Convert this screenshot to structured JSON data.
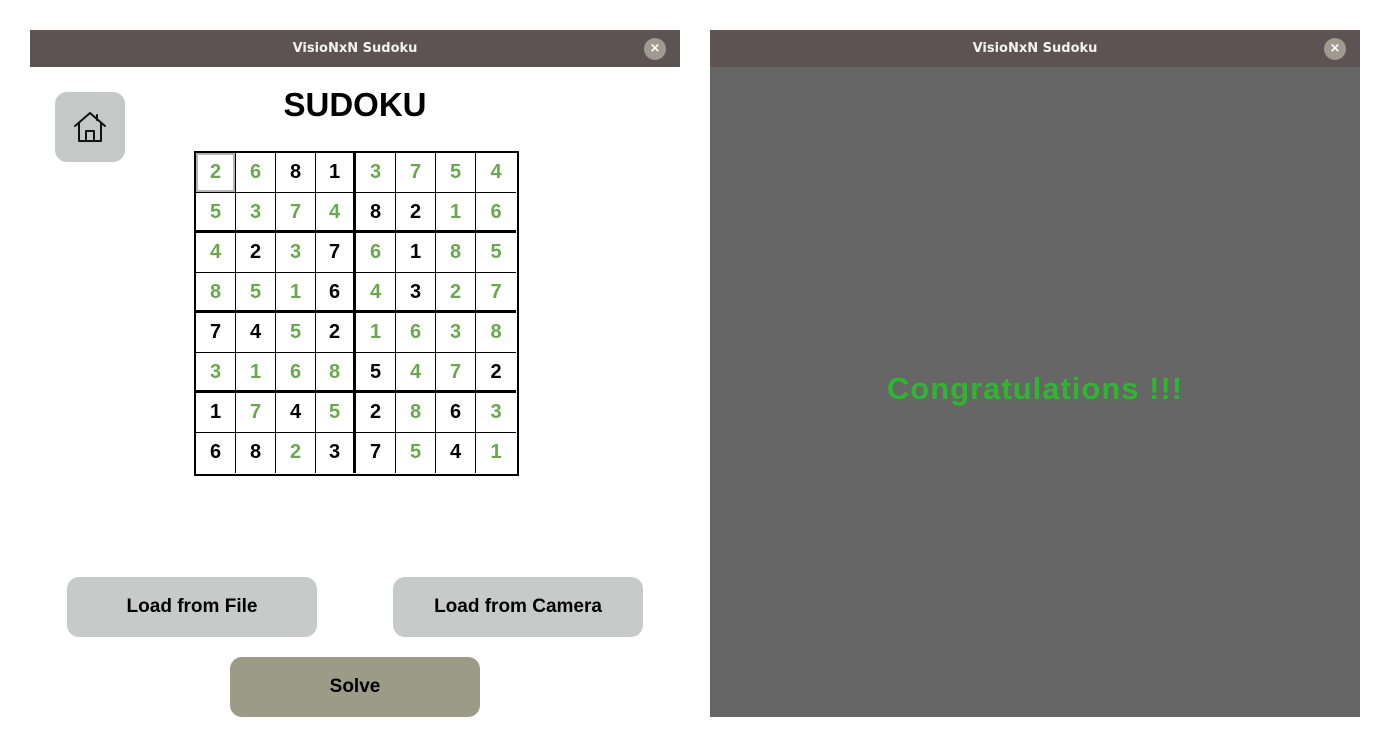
{
  "left_window": {
    "title": "VisioNxN Sudoku",
    "close_glyph": "×",
    "home_icon": "home-icon",
    "page_title": "SUDOKU",
    "grid": [
      [
        "2",
        "6",
        "8",
        "1",
        "3",
        "7",
        "5",
        "4"
      ],
      [
        "5",
        "3",
        "7",
        "4",
        "8",
        "2",
        "1",
        "6"
      ],
      [
        "4",
        "2",
        "3",
        "7",
        "6",
        "1",
        "8",
        "5"
      ],
      [
        "8",
        "5",
        "1",
        "6",
        "4",
        "3",
        "2",
        "7"
      ],
      [
        "7",
        "4",
        "5",
        "2",
        "1",
        "6",
        "3",
        "8"
      ],
      [
        "3",
        "1",
        "6",
        "8",
        "5",
        "4",
        "7",
        "2"
      ],
      [
        "1",
        "7",
        "4",
        "5",
        "2",
        "8",
        "6",
        "3"
      ],
      [
        "6",
        "8",
        "2",
        "3",
        "7",
        "5",
        "4",
        "1"
      ]
    ],
    "given_mask": [
      [
        0,
        0,
        1,
        1,
        0,
        0,
        0,
        0
      ],
      [
        0,
        0,
        0,
        0,
        1,
        1,
        0,
        0
      ],
      [
        0,
        1,
        0,
        1,
        0,
        1,
        0,
        0
      ],
      [
        0,
        0,
        0,
        1,
        0,
        1,
        0,
        0
      ],
      [
        1,
        1,
        0,
        1,
        0,
        0,
        0,
        0
      ],
      [
        0,
        0,
        0,
        0,
        1,
        0,
        0,
        1
      ],
      [
        1,
        0,
        1,
        0,
        1,
        0,
        1,
        0
      ],
      [
        1,
        1,
        0,
        1,
        1,
        0,
        1,
        0
      ]
    ],
    "selected_cell": [
      0,
      0
    ],
    "colors": {
      "given": "#000000",
      "solved": "#6aa84f"
    },
    "buttons": {
      "load_file": "Load from File",
      "load_camera": "Load from Camera",
      "solve": "Solve"
    }
  },
  "right_window": {
    "title": "VisioNxN Sudoku",
    "close_glyph": "×",
    "message": "Congratulations !!!",
    "message_color": "#2fb52f"
  }
}
